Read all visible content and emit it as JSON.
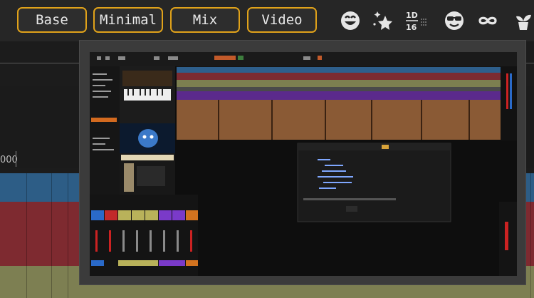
{
  "layouts": [
    {
      "label": "Base"
    },
    {
      "label": "Minimal"
    },
    {
      "label": "Mix"
    },
    {
      "label": "Video"
    }
  ],
  "toolbar_icons": [
    "smiley-icon",
    "sparkle-star-icon",
    "grid-note-icon",
    "sunglasses-icon",
    "infinity-icon",
    "plant-icon"
  ],
  "grid_icon_text": {
    "top": "1D",
    "bottom": "16"
  },
  "ruler": {
    "visible_text": "000"
  },
  "colors": {
    "accent": "#e0a21a",
    "track_blue": "#2d5d86",
    "track_red": "#7e2a30",
    "track_olive": "#7d7f52"
  }
}
